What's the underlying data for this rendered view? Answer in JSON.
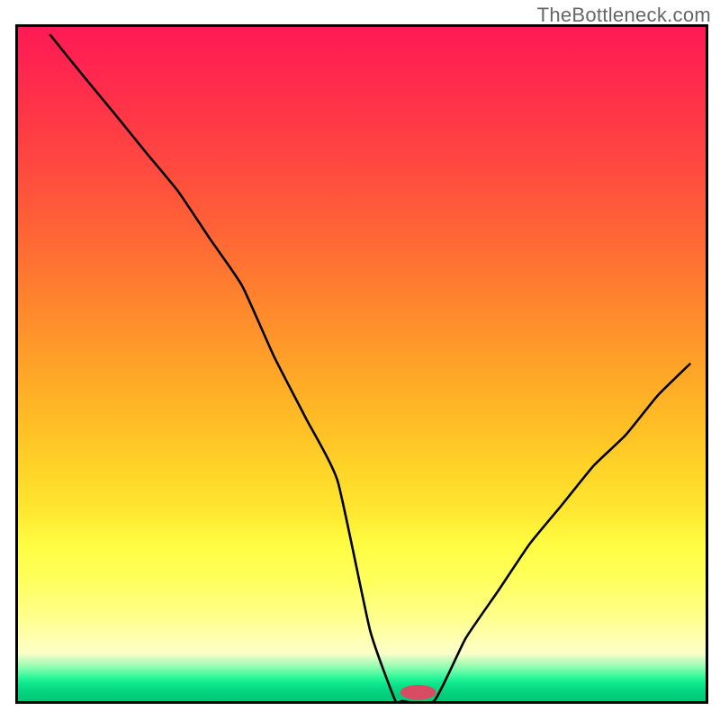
{
  "watermark": "TheBottleneck.com",
  "chart_data": {
    "type": "line",
    "title": "",
    "xlabel": "",
    "ylabel": "",
    "xlim": [
      0,
      1
    ],
    "ylim": [
      0,
      1
    ],
    "grid": false,
    "gradient_stops": [
      {
        "offset": 0.0,
        "color": "#ff1a54"
      },
      {
        "offset": 0.05,
        "color": "#ff2450"
      },
      {
        "offset": 0.1,
        "color": "#ff2f4a"
      },
      {
        "offset": 0.15,
        "color": "#ff3b45"
      },
      {
        "offset": 0.2,
        "color": "#ff4740"
      },
      {
        "offset": 0.25,
        "color": "#ff553b"
      },
      {
        "offset": 0.3,
        "color": "#ff6336"
      },
      {
        "offset": 0.35,
        "color": "#ff7232"
      },
      {
        "offset": 0.4,
        "color": "#ff822e"
      },
      {
        "offset": 0.45,
        "color": "#ff922b"
      },
      {
        "offset": 0.5,
        "color": "#ffa228"
      },
      {
        "offset": 0.55,
        "color": "#ffb226"
      },
      {
        "offset": 0.6,
        "color": "#ffc126"
      },
      {
        "offset": 0.625,
        "color": "#ffca27"
      },
      {
        "offset": 0.65,
        "color": "#ffd228"
      },
      {
        "offset": 0.7,
        "color": "#ffe22d"
      },
      {
        "offset": 0.725,
        "color": "#ffe932"
      },
      {
        "offset": 0.755,
        "color": "#fff73e"
      },
      {
        "offset": 0.775,
        "color": "#fffd45"
      },
      {
        "offset": 0.82,
        "color": "#ffff5d"
      },
      {
        "offset": 0.87,
        "color": "#ffff87"
      },
      {
        "offset": 0.9,
        "color": "#ffffa8"
      },
      {
        "offset": 0.915,
        "color": "#ffffba"
      },
      {
        "offset": 0.93,
        "color": "#faffc6"
      },
      {
        "offset": 0.935,
        "color": "#ddfcc3"
      },
      {
        "offset": 0.94,
        "color": "#c2fcbd"
      },
      {
        "offset": 0.945,
        "color": "#a8fcb7"
      },
      {
        "offset": 0.95,
        "color": "#8cfcb0"
      },
      {
        "offset": 0.955,
        "color": "#6dfba9"
      },
      {
        "offset": 0.96,
        "color": "#4ef9a2"
      },
      {
        "offset": 0.965,
        "color": "#2df69a"
      },
      {
        "offset": 0.97,
        "color": "#18ef93"
      },
      {
        "offset": 0.975,
        "color": "#0ee58b"
      },
      {
        "offset": 0.98,
        "color": "#0adc86"
      },
      {
        "offset": 0.985,
        "color": "#05d681"
      },
      {
        "offset": 0.992,
        "color": "#01cd7b"
      },
      {
        "offset": 1.0,
        "color": "#00c977"
      }
    ],
    "series": [
      {
        "name": "bottleneck-curve",
        "stroke": "#000000",
        "x": [
          0.047,
          0.093,
          0.14,
          0.186,
          0.233,
          0.279,
          0.326,
          0.372,
          0.419,
          0.465,
          0.512,
          0.549,
          0.558,
          0.605,
          0.651,
          0.698,
          0.744,
          0.791,
          0.837,
          0.884,
          0.93,
          0.977
        ],
        "y": [
          0.988,
          0.93,
          0.872,
          0.814,
          0.756,
          0.686,
          0.616,
          0.512,
          0.419,
          0.326,
          0.105,
          0.0,
          0.0,
          0.0,
          0.093,
          0.163,
          0.233,
          0.291,
          0.349,
          0.395,
          0.453,
          0.5
        ]
      }
    ],
    "marker": {
      "name": "highlight-pill",
      "cx": 0.582,
      "cy": 0.013,
      "rx": 0.026,
      "ry": 0.011,
      "fill": "#d94a63"
    }
  }
}
